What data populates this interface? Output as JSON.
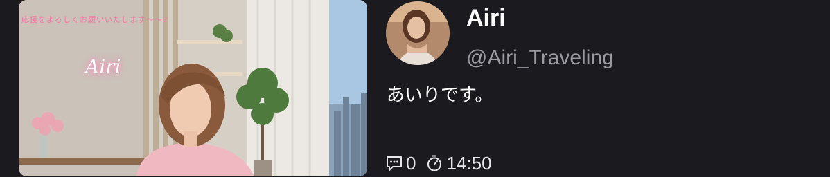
{
  "thumbnail": {
    "overlay_text": "応援をよろしくお願いいたします〜〜♪",
    "neon_sign": "Airi"
  },
  "profile": {
    "display_name": "Airi",
    "handle": "@Airi_Traveling",
    "bio": "あいりです。"
  },
  "stats": {
    "comment_count": "0",
    "duration": "14:50",
    "comment_icon": "comment-icon",
    "timer_icon": "stopwatch-icon"
  },
  "colors": {
    "background": "#1b1b1f",
    "handle": "#9a9aa0",
    "overlay_pink": "#ff6fa5"
  }
}
